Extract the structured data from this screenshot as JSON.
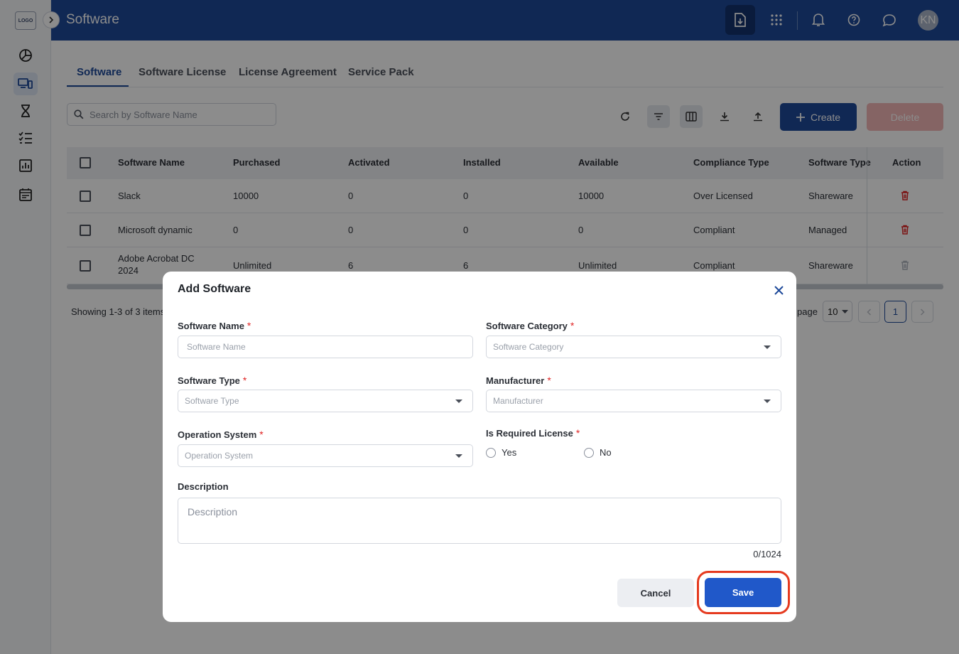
{
  "colors": {
    "brand": "#1e4a9a",
    "save": "#2058c9",
    "danger": "#e02424",
    "highlight": "#e53a1f"
  },
  "sidebar": {
    "logo_text": "LOGO",
    "items": [
      {
        "icon": "pie-chart-icon"
      },
      {
        "icon": "devices-icon",
        "active": true
      },
      {
        "icon": "hourglass-icon"
      },
      {
        "icon": "checklist-icon"
      },
      {
        "icon": "report-chart-icon"
      },
      {
        "icon": "calendar-icon"
      }
    ]
  },
  "header": {
    "title": "Software",
    "icons": [
      "download-file-icon",
      "apps-grid-icon",
      "bell-icon",
      "help-icon",
      "chat-icon"
    ],
    "avatar_initials": "KN"
  },
  "tabs": [
    {
      "label": "Software",
      "active": true
    },
    {
      "label": "Software License"
    },
    {
      "label": "License Agreement"
    },
    {
      "label": "Service Pack"
    }
  ],
  "search": {
    "placeholder": "Search by Software Name",
    "value": ""
  },
  "toolbar": {
    "create_label": "Create",
    "delete_label": "Delete"
  },
  "table": {
    "columns": [
      "Software Name",
      "Purchased",
      "Activated",
      "Installed",
      "Available",
      "Compliance Type",
      "Software Type",
      "Action"
    ],
    "rows": [
      {
        "name": "Slack",
        "purchased": "10000",
        "activated": "0",
        "installed": "0",
        "available": "10000",
        "compliance": "Over Licensed",
        "type": "Shareware"
      },
      {
        "name": "Microsoft dynamic",
        "purchased": "0",
        "activated": "0",
        "installed": "0",
        "available": "0",
        "compliance": "Compliant",
        "type": "Managed"
      },
      {
        "name": "Adobe Acrobat DC 2024",
        "purchased": "Unlimited",
        "activated": "6",
        "installed": "6",
        "available": "Unlimited",
        "compliance": "Compliant",
        "type": "Shareware"
      }
    ]
  },
  "pagination": {
    "showing": "Showing 1-3 of 3 items",
    "per_page_label": "page",
    "per_page_value": "10",
    "current_page": "1"
  },
  "modal": {
    "title": "Add Software",
    "fields": {
      "software_name": {
        "label": "Software Name",
        "placeholder": "Software Name",
        "required": true
      },
      "software_category": {
        "label": "Software Category",
        "placeholder": "Software Category",
        "required": true
      },
      "software_type": {
        "label": "Software Type",
        "placeholder": "Software Type",
        "required": true
      },
      "manufacturer": {
        "label": "Manufacturer",
        "placeholder": "Manufacturer",
        "required": true
      },
      "operation_system": {
        "label": "Operation System",
        "placeholder": "Operation System",
        "required": true
      },
      "is_required_license": {
        "label": "Is Required License",
        "required": true,
        "options": [
          "Yes",
          "No"
        ]
      },
      "description": {
        "label": "Description",
        "placeholder": "Description",
        "counter": "0/1024"
      }
    },
    "required_mark": "*",
    "cancel_label": "Cancel",
    "save_label": "Save"
  }
}
